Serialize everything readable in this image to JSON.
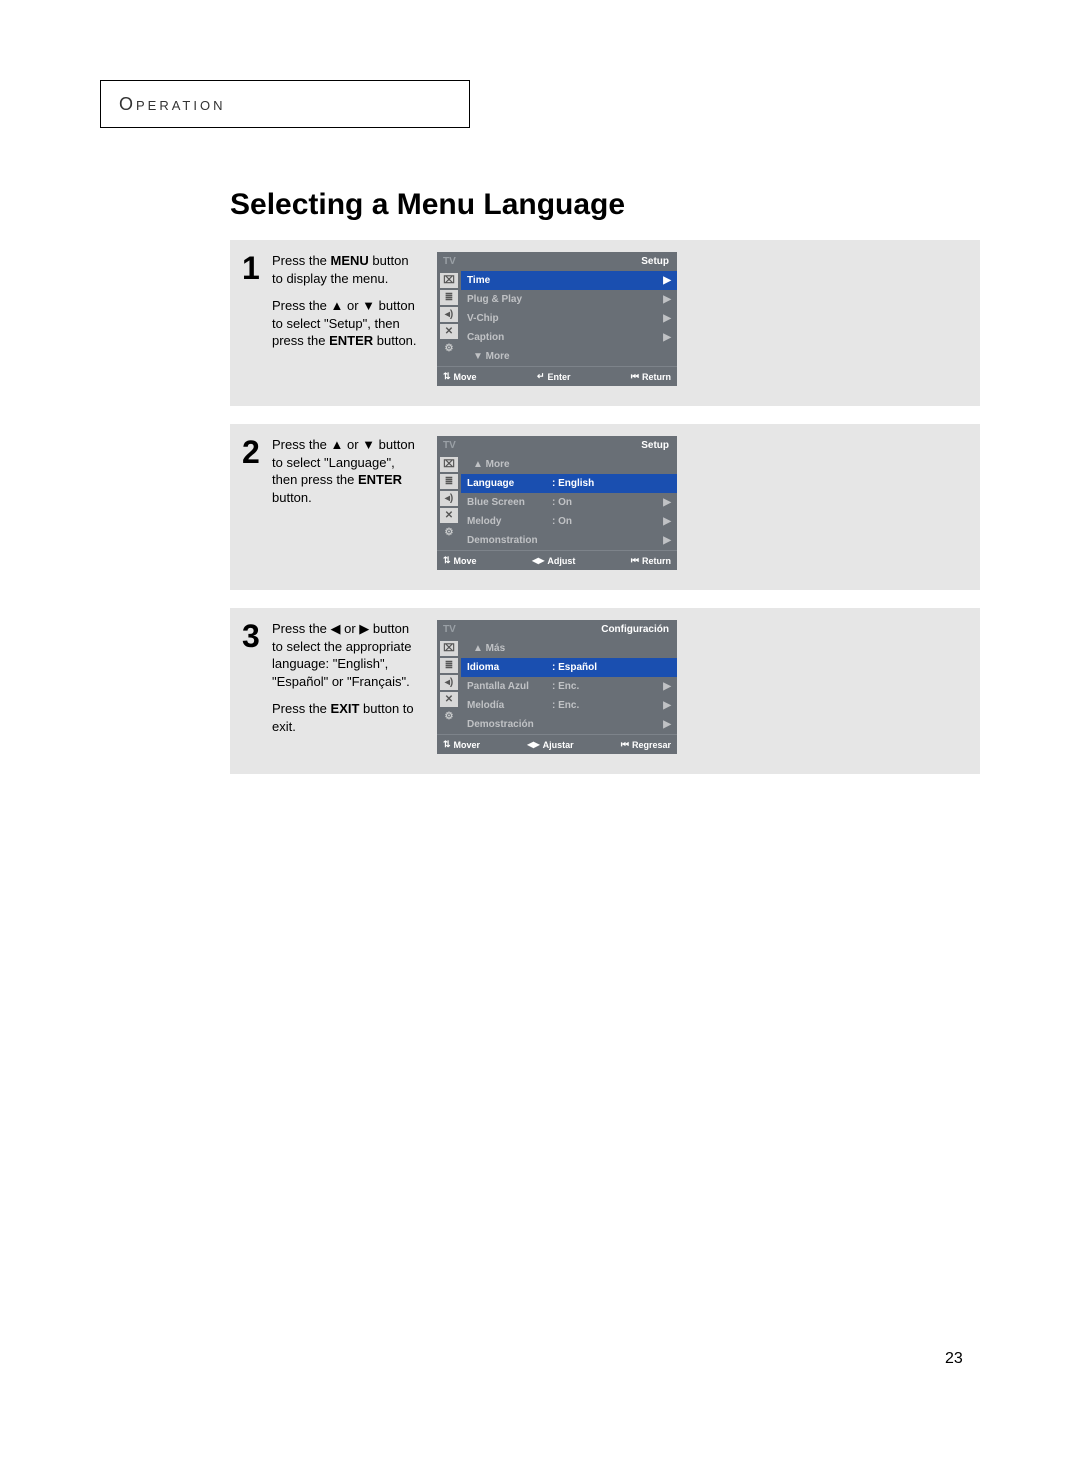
{
  "header": {
    "operation": "Operation"
  },
  "title": "Selecting a Menu Language",
  "page_number": "23",
  "steps": [
    {
      "num": "1",
      "para1_a": "Press the ",
      "para1_b": "MENU",
      "para1_c": " button to display the menu.",
      "para2_a": "Press the ▲ or ▼ button to select \"Setup\", then press the ",
      "para2_b": "ENTER",
      "para2_c": " button.",
      "osd": {
        "tv": "TV",
        "section": "Setup",
        "rows": [
          {
            "label": "Time",
            "value": "",
            "sel": true,
            "arrow": "▶"
          },
          {
            "label": "Plug & Play",
            "value": "",
            "arrow": "▶"
          },
          {
            "label": "V-Chip",
            "value": "",
            "arrow": "▶"
          },
          {
            "label": "Caption",
            "value": "",
            "arrow": "▶"
          },
          {
            "label": "▼ More",
            "value": "",
            "arrow": ""
          }
        ],
        "footer": {
          "move": "Move",
          "mid_icon": "↵",
          "mid": "Enter",
          "ret": "Return"
        }
      }
    },
    {
      "num": "2",
      "para1_a": "Press the ▲ or ▼ button to select \"Language\", then press the ",
      "para1_b": "ENTER",
      "para1_c": " button.",
      "osd": {
        "tv": "TV",
        "section": "Setup",
        "rows": [
          {
            "label": "▲ More",
            "value": "",
            "arrow": ""
          },
          {
            "label": "Language",
            "value": ": English",
            "sel": true,
            "arrow": ""
          },
          {
            "label": "Blue Screen",
            "value": ": On",
            "arrow": "▶"
          },
          {
            "label": "Melody",
            "value": ": On",
            "arrow": "▶"
          },
          {
            "label": "Demonstration",
            "value": "",
            "arrow": "▶"
          }
        ],
        "footer": {
          "move": "Move",
          "mid_icon": "◀▶",
          "mid": "Adjust",
          "ret": "Return"
        }
      }
    },
    {
      "num": "3",
      "para1_a": "Press the ◀ or ▶ button to select the appropriate language: \"English\", \"Español\" or \"Français\".",
      "para2_a": "Press the ",
      "para2_b": "EXIT",
      "para2_c": " button to exit.",
      "osd": {
        "tv": "TV",
        "section": "Configuración",
        "rows": [
          {
            "label": "▲ Más",
            "value": "",
            "arrow": ""
          },
          {
            "label": "Idioma",
            "value": ": Español",
            "sel": true,
            "arrow": ""
          },
          {
            "label": "Pantalla Azul",
            "value": ": Enc.",
            "arrow": "▶"
          },
          {
            "label": "Melodía",
            "value": ": Enc.",
            "arrow": "▶"
          },
          {
            "label": "Demostración",
            "value": "",
            "arrow": "▶"
          }
        ],
        "footer": {
          "move": "Mover",
          "mid_icon": "◀▶",
          "mid": "Ajustar",
          "ret": "Regresar"
        }
      }
    }
  ]
}
